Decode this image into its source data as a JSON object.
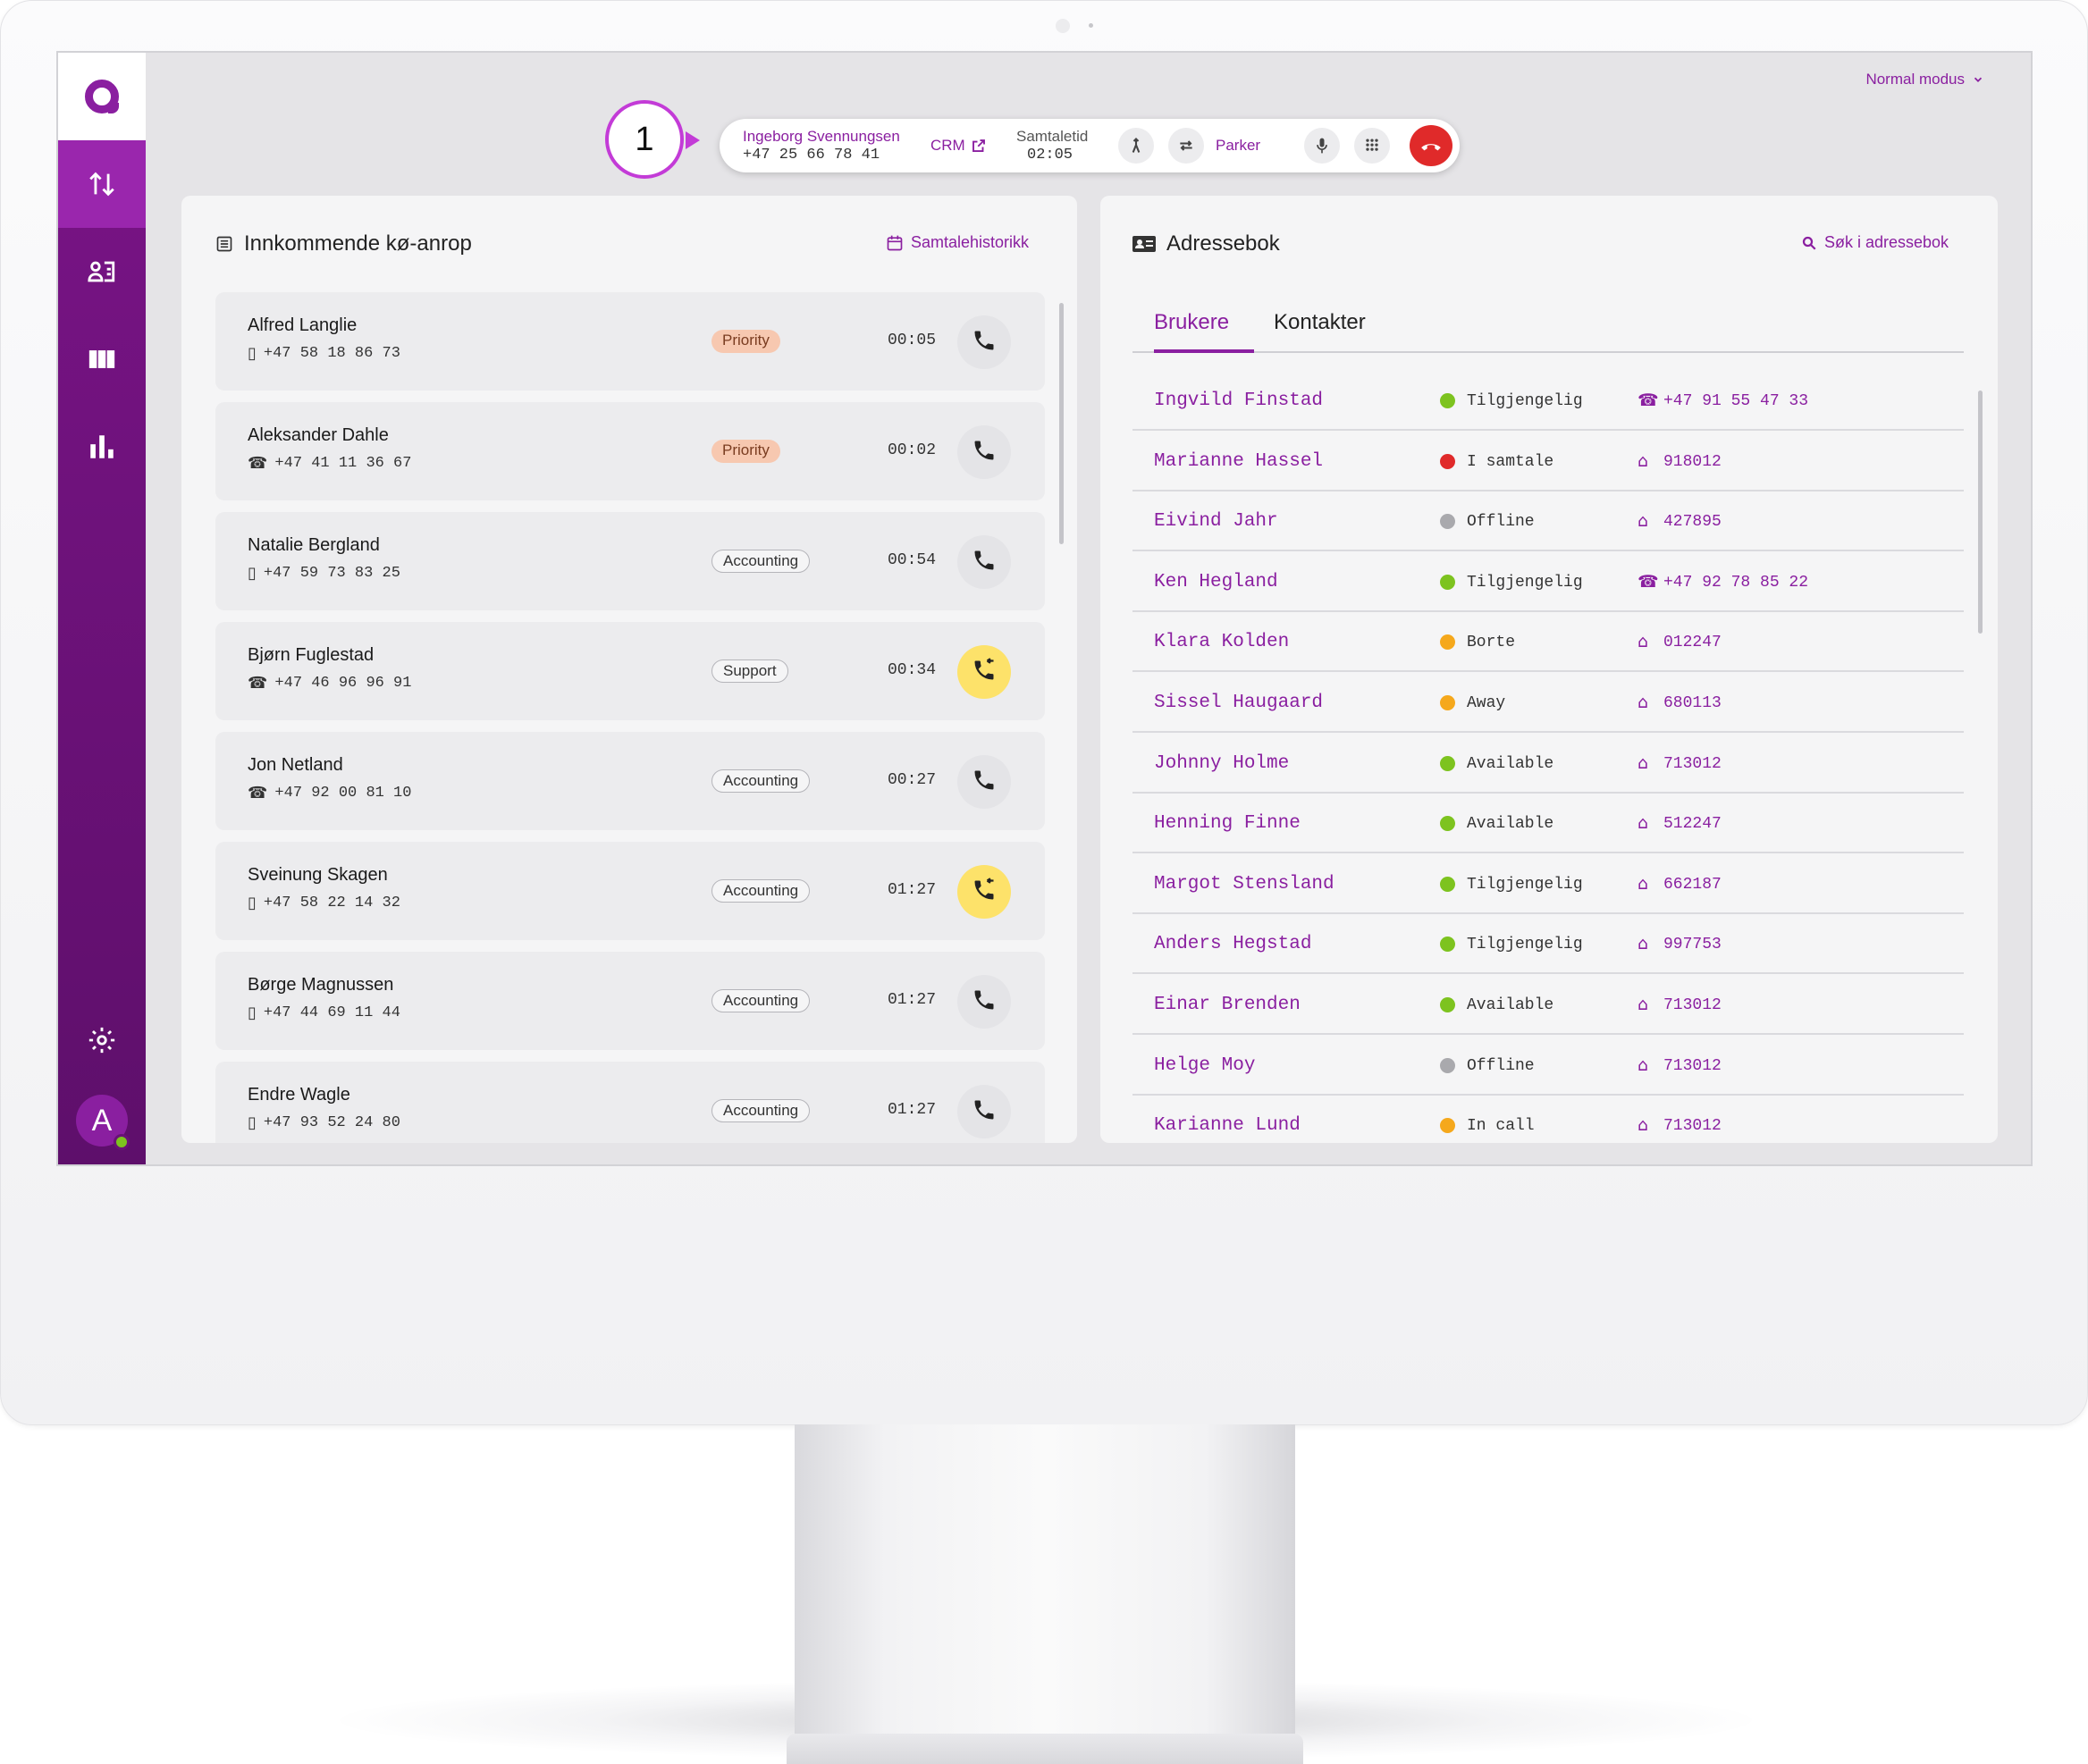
{
  "colors": {
    "brand": "#8a1fa0",
    "sidebar": "#6a1177",
    "hangup": "#e02a2a",
    "available": "#7dc31f",
    "busy": "#e02a2a",
    "away": "#f5a81c",
    "offline": "#a9a9ad",
    "callback": "#fde26a"
  },
  "topbar": {
    "mode_label": "Normal modus"
  },
  "marker": {
    "number": "1"
  },
  "call": {
    "caller_name": "Ingeborg Svennungsen",
    "caller_number": "+47 25 66 78 41",
    "crm_label": "CRM",
    "talk_time_label": "Samtaletid",
    "talk_time": "02:05",
    "park_label": "Parker"
  },
  "sidebar": {
    "avatar_initial": "A",
    "items": [
      {
        "icon": "call-queue-icon",
        "active": true
      },
      {
        "icon": "contacts-icon",
        "active": false
      },
      {
        "icon": "columns-icon",
        "active": false
      },
      {
        "icon": "statistics-icon",
        "active": false
      }
    ]
  },
  "queue": {
    "title": "Innkommende kø-anrop",
    "history_link": "Samtalehistorikk",
    "calls": [
      {
        "name": "Alfred Langlie",
        "number": "+47 58 18 86 73",
        "device": "mobile",
        "tag": "Priority",
        "time": "00:05",
        "callback": false
      },
      {
        "name": "Aleksander Dahle",
        "number": "+47 41 11 36 67",
        "device": "landline",
        "tag": "Priority",
        "time": "00:02",
        "callback": false
      },
      {
        "name": "Natalie Bergland",
        "number": "+47 59 73 83 25",
        "device": "mobile",
        "tag": "Accounting",
        "time": "00:54",
        "callback": false
      },
      {
        "name": "Bjørn Fuglestad",
        "number": "+47 46 96 96 91",
        "device": "landline",
        "tag": "Support",
        "time": "00:34",
        "callback": true
      },
      {
        "name": "Jon Netland",
        "number": "+47 92 00 81 10",
        "device": "landline",
        "tag": "Accounting",
        "time": "00:27",
        "callback": false
      },
      {
        "name": "Sveinung Skagen",
        "number": "+47 58 22 14 32",
        "device": "mobile",
        "tag": "Accounting",
        "time": "01:27",
        "callback": true
      },
      {
        "name": "Børge Magnussen",
        "number": "+47 44 69 11 44",
        "device": "mobile",
        "tag": "Accounting",
        "time": "01:27",
        "callback": false
      },
      {
        "name": "Endre Wagle",
        "number": "+47 93 52 24 80",
        "device": "mobile",
        "tag": "Accounting",
        "time": "01:27",
        "callback": false
      }
    ]
  },
  "addressbook": {
    "title": "Adressebok",
    "search_link": "Søk i adressebok",
    "tabs": [
      {
        "label": "Brukere",
        "active": true
      },
      {
        "label": "Kontakter",
        "active": false
      }
    ],
    "entries": [
      {
        "name": "Ingvild Finstad",
        "status": "Tilgjengelig",
        "state": "available",
        "contact": "+47 91 55 47 33",
        "contact_type": "phone"
      },
      {
        "name": "Marianne Hassel",
        "status": "I samtale",
        "state": "busy",
        "contact": "918012",
        "contact_type": "extension"
      },
      {
        "name": "Eivind Jahr",
        "status": "Offline",
        "state": "offline",
        "contact": "427895",
        "contact_type": "extension"
      },
      {
        "name": "Ken Hegland",
        "status": "Tilgjengelig",
        "state": "available",
        "contact": "+47 92 78 85 22",
        "contact_type": "phone"
      },
      {
        "name": "Klara Kolden",
        "status": "Borte",
        "state": "away",
        "contact": "012247",
        "contact_type": "extension"
      },
      {
        "name": "Sissel Haugaard",
        "status": "Away",
        "state": "away",
        "contact": "680113",
        "contact_type": "extension"
      },
      {
        "name": "Johnny Holme",
        "status": "Available",
        "state": "available",
        "contact": "713012",
        "contact_type": "extension"
      },
      {
        "name": "Henning Finne",
        "status": "Available",
        "state": "available",
        "contact": "512247",
        "contact_type": "extension"
      },
      {
        "name": "Margot Stensland",
        "status": "Tilgjengelig",
        "state": "available",
        "contact": "662187",
        "contact_type": "extension"
      },
      {
        "name": "Anders Hegstad",
        "status": "Tilgjengelig",
        "state": "available",
        "contact": "997753",
        "contact_type": "extension"
      },
      {
        "name": "Einar Brenden",
        "status": "Available",
        "state": "available",
        "contact": "713012",
        "contact_type": "extension"
      },
      {
        "name": "Helge Moy",
        "status": "Offline",
        "state": "offline",
        "contact": "713012",
        "contact_type": "extension"
      },
      {
        "name": "Karianne Lund",
        "status": "In call",
        "state": "away",
        "contact": "713012",
        "contact_type": "extension"
      }
    ]
  }
}
